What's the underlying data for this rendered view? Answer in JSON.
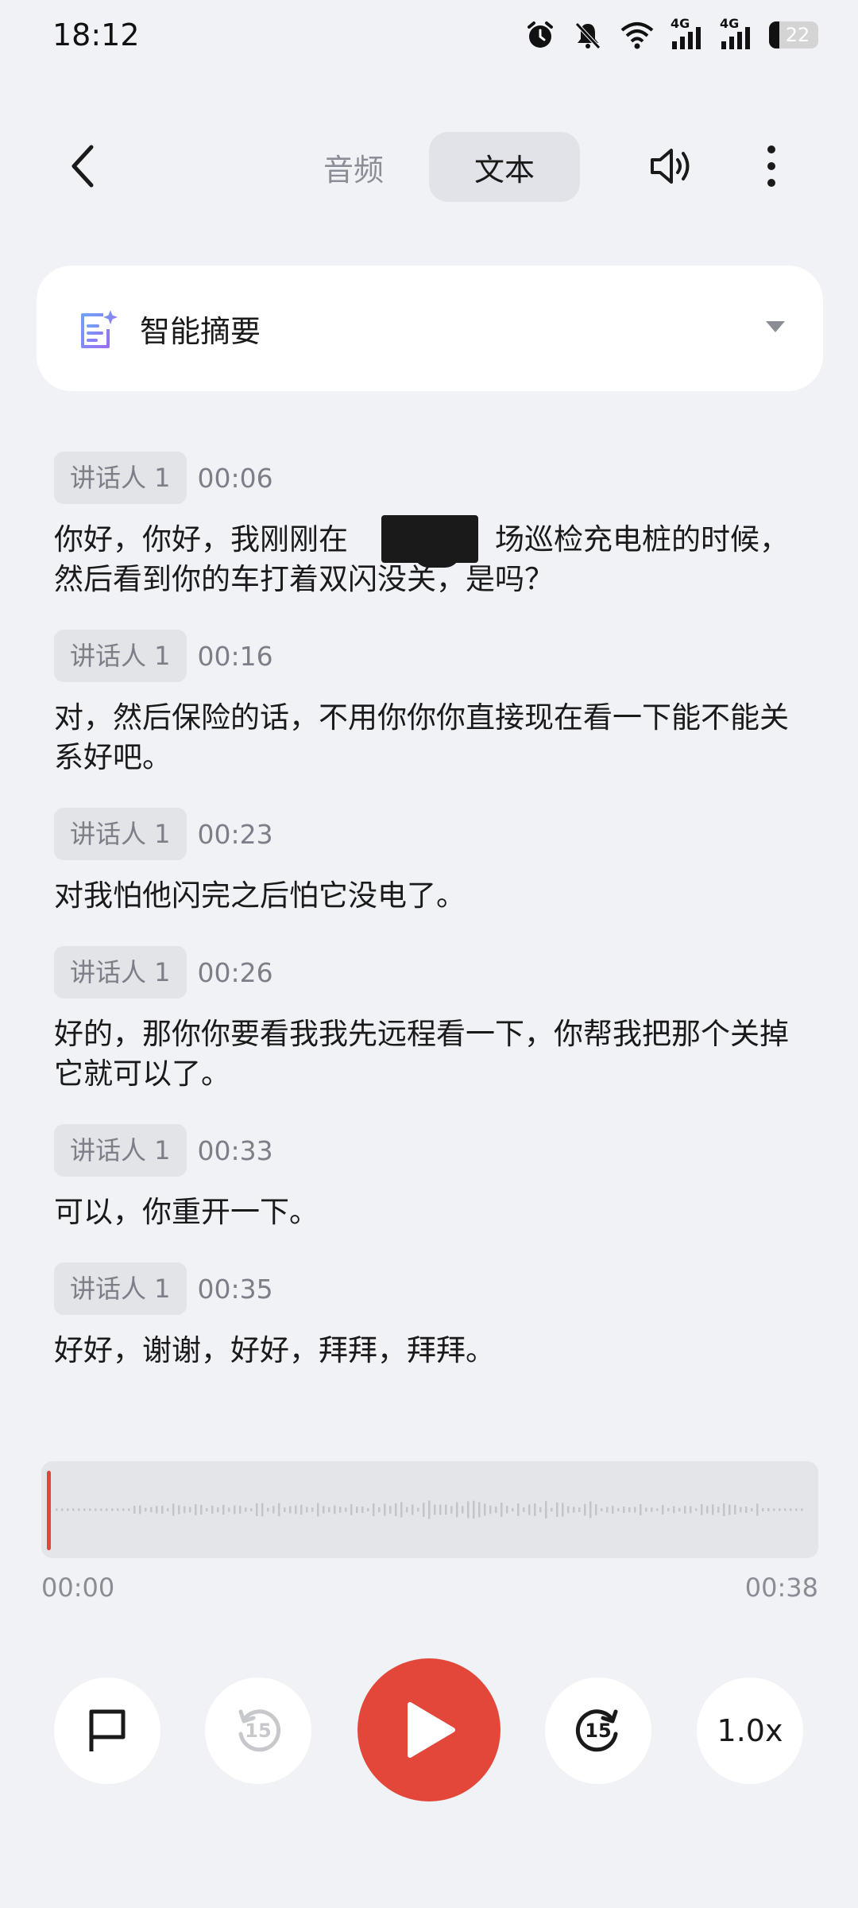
{
  "status_bar": {
    "time": "18:12",
    "battery": "22",
    "network_a": "4G",
    "network_b": "4G"
  },
  "tabs": {
    "audio": "音频",
    "text": "文本",
    "active": "text"
  },
  "summary": {
    "label": "智能摘要"
  },
  "transcript": [
    {
      "speaker": "讲话人 1",
      "time": "00:06",
      "text": "你好，你好，我刚刚在　　　　　场巡检充电桩的时候，然后看到你的车打着双闪没关，是吗？"
    },
    {
      "speaker": "讲话人 1",
      "time": "00:16",
      "text": "对，然后保险的话，不用你你你直接现在看一下能不能关系好吧。"
    },
    {
      "speaker": "讲话人 1",
      "time": "00:23",
      "text": "对我怕他闪完之后怕它没电了。"
    },
    {
      "speaker": "讲话人 1",
      "time": "00:26",
      "text": "好的，那你你要看我我先远程看一下，你帮我把那个关掉它就可以了。"
    },
    {
      "speaker": "讲话人 1",
      "time": "00:33",
      "text": "可以，你重开一下。"
    },
    {
      "speaker": "讲话人 1",
      "time": "00:35",
      "text": "好好，谢谢，好好，拜拜，拜拜。"
    }
  ],
  "player": {
    "current_time": "00:00",
    "total_time": "00:38",
    "progress": 0,
    "rewind_seconds": "15",
    "forward_seconds": "15",
    "speed": "1.0x",
    "accent_color": "#e2473a"
  }
}
